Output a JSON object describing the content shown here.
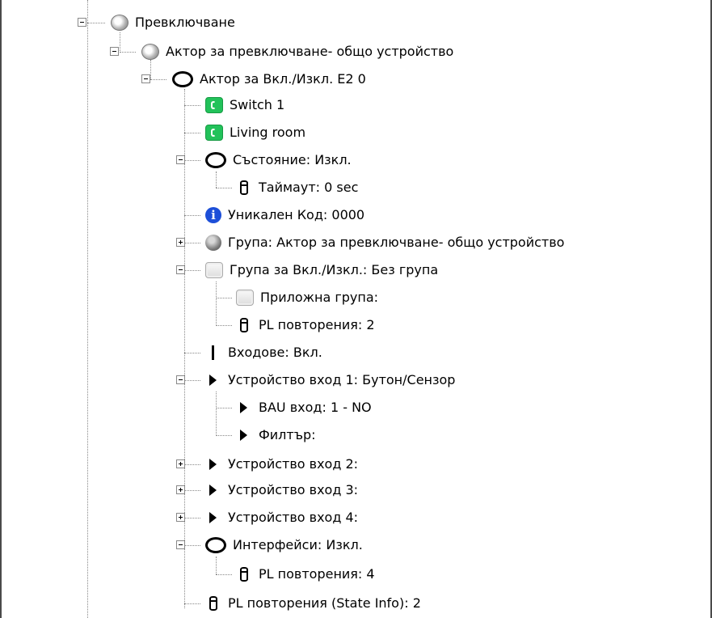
{
  "tree": {
    "rows": [
      {
        "label": "Превключване",
        "icon": "globe-icon",
        "expander": "minus"
      },
      {
        "label": "Актор за превключване- общо устройство",
        "icon": "globe-icon",
        "expander": "minus"
      },
      {
        "label": "Актор за Вкл./Изкл. E2 0",
        "icon": "circle-icon",
        "expander": "minus"
      },
      {
        "label": "Switch 1",
        "icon": "green-switch-icon"
      },
      {
        "label": "Living room",
        "icon": "green-switch-icon"
      },
      {
        "label": "Състояние: Изкл.",
        "icon": "circle-icon",
        "expander": "minus"
      },
      {
        "label": "Таймаут: 0 sec",
        "icon": "cylinder-icon"
      },
      {
        "label": "Уникален Код: 0000",
        "icon": "info-icon"
      },
      {
        "label": "Група: Актор за превключване- общо устройство",
        "icon": "group-icon",
        "expander": "plus"
      },
      {
        "label": "Група за Вкл./Изкл.: Без група",
        "icon": "square-icon",
        "expander": "minus"
      },
      {
        "label": "Приложна група:",
        "icon": "square-icon"
      },
      {
        "label": "PL повторения: 2",
        "icon": "cylinder-icon"
      },
      {
        "label": "Входове: Вкл.",
        "icon": "bar-icon"
      },
      {
        "label": "Устройство вход 1: Бутон/Сензор",
        "icon": "triangle-icon",
        "expander": "minus"
      },
      {
        "label": "BAU вход: 1 - NO",
        "icon": "triangle-icon"
      },
      {
        "label": "Филтър:",
        "icon": "triangle-icon"
      },
      {
        "label": "Устройство вход 2:",
        "icon": "triangle-icon",
        "expander": "plus"
      },
      {
        "label": "Устройство вход 3:",
        "icon": "triangle-icon",
        "expander": "plus"
      },
      {
        "label": "Устройство вход 4:",
        "icon": "triangle-icon",
        "expander": "plus"
      },
      {
        "label": "Интерфейси: Изкл.",
        "icon": "circle-icon",
        "expander": "minus"
      },
      {
        "label": "PL повторения: 4",
        "icon": "cylinder-icon"
      },
      {
        "label": "PL повторения (State Info): 2",
        "icon": "cylinder-icon"
      }
    ]
  }
}
